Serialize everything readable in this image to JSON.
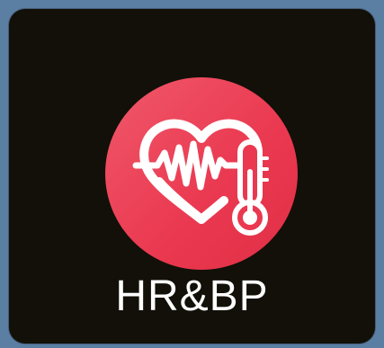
{
  "app": {
    "name": "HR&BP",
    "icon": "heart-pulse-thermometer-icon"
  },
  "colors": {
    "background": "#5b7ea3",
    "tile": "#121008",
    "icon_accent": "#ea3850",
    "icon_glyph": "#ffffff",
    "label": "#ffffff"
  }
}
